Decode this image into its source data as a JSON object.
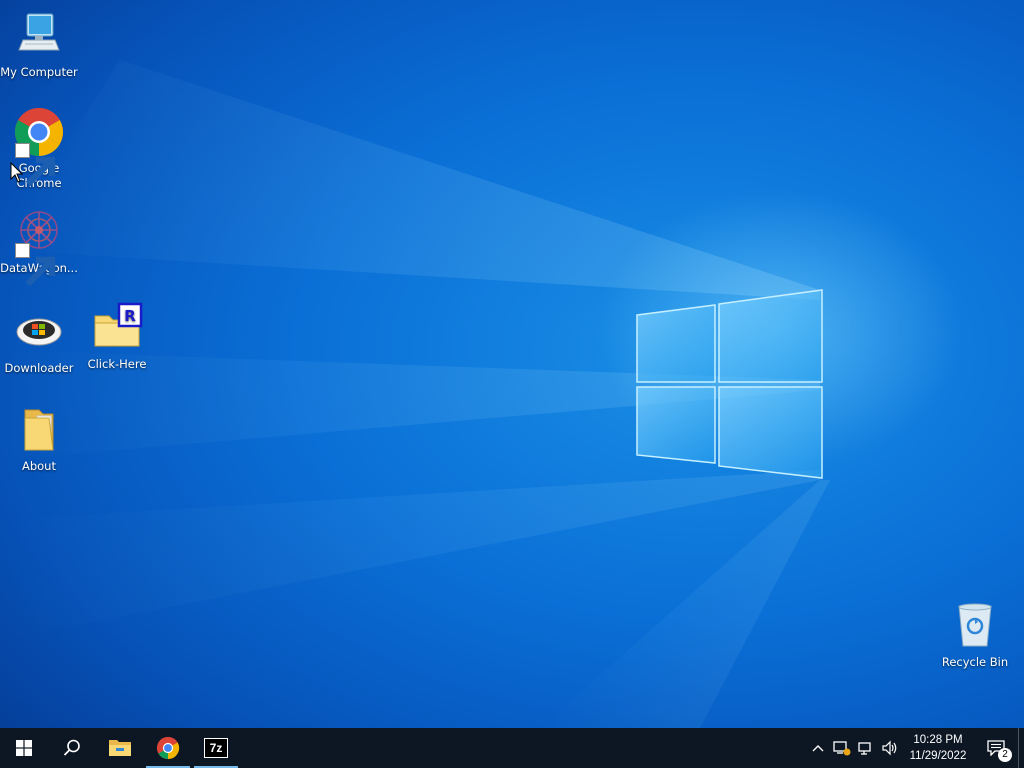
{
  "desktop": {
    "icons": [
      {
        "label": "My Computer",
        "icon": "computer-icon"
      },
      {
        "label": "Google Chrome",
        "icon": "chrome-icon"
      },
      {
        "label": "DataWagon...",
        "icon": "datawagon-icon"
      },
      {
        "label": "Downloader",
        "icon": "downloader-icon"
      },
      {
        "label": "Click-Here",
        "icon": "folder-r-icon"
      },
      {
        "label": "About",
        "icon": "folder-icon"
      },
      {
        "label": "Recycle Bin",
        "icon": "recycle-bin-icon"
      }
    ]
  },
  "taskbar": {
    "pinned": [
      {
        "name": "start-button",
        "icon": "windows-logo-icon"
      },
      {
        "name": "search-button",
        "icon": "search-icon"
      },
      {
        "name": "file-explorer-button",
        "icon": "folder-icon"
      },
      {
        "name": "chrome-button",
        "icon": "chrome-icon"
      },
      {
        "name": "7zip-button",
        "icon": "7zip-icon",
        "label": "7z"
      }
    ],
    "tray": {
      "icons": [
        "chevron-up-icon",
        "network-alert-icon",
        "network-icon",
        "volume-icon"
      ],
      "time": "10:28 PM",
      "date": "11/29/2022",
      "notification_count": "2"
    }
  }
}
